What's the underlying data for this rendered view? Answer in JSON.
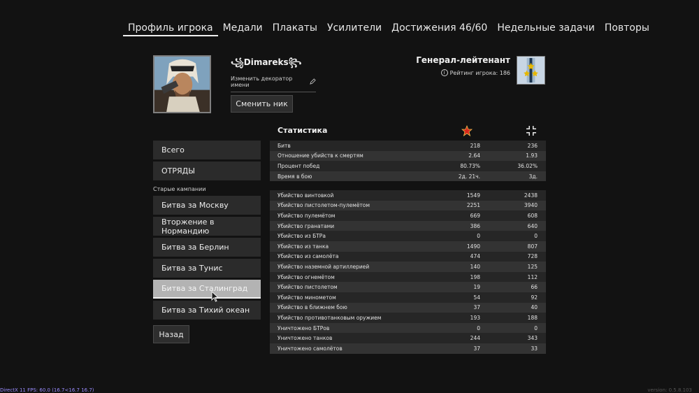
{
  "nav": {
    "tabs": [
      {
        "label": "Профиль игрока",
        "active": true
      },
      {
        "label": "Медали"
      },
      {
        "label": "Плакаты"
      },
      {
        "label": "Усилители"
      },
      {
        "label": "Достижения 46/60"
      },
      {
        "label": "Недельные задачи"
      },
      {
        "label": "Повторы"
      }
    ]
  },
  "profile": {
    "nickname": "꧁Dimareks꧂",
    "decorator_label": "Изменить декоратор имени",
    "change_nick_label": "Сменить ник",
    "rank_name": "Генерал-лейтенант",
    "rating_label": "Рейтинг игрока: 186"
  },
  "menu": {
    "all_label": "Всего",
    "squads_label": "ОТРЯДЫ",
    "old_campaigns_label": "Старые кампании",
    "campaigns": [
      "Битва за Москву",
      "Вторжение в Нормандию",
      "Битва за Берлин",
      "Битва за Тунис",
      "Битва за Сталинград",
      "Битва за Тихий океан"
    ],
    "active_campaign": "Битва за Сталинград",
    "back_label": "Назад"
  },
  "stats": {
    "title": "Статистика",
    "summary": [
      {
        "label": "Битв",
        "allies": "218",
        "axis": "236"
      },
      {
        "label": "Отношение убийств к смертям",
        "allies": "2.64",
        "axis": "1.93"
      },
      {
        "label": "Процент побед",
        "allies": "80.73%",
        "axis": "36.02%"
      },
      {
        "label": "Время в бою",
        "allies": "2д. 21ч.",
        "axis": "3д."
      }
    ],
    "kills": [
      {
        "label": "Убийство винтовкой",
        "allies": "1549",
        "axis": "2438"
      },
      {
        "label": "Убийство пистолетом-пулемётом",
        "allies": "2251",
        "axis": "3940"
      },
      {
        "label": "Убийство пулемётом",
        "allies": "669",
        "axis": "608"
      },
      {
        "label": "Убийство гранатами",
        "allies": "386",
        "axis": "640"
      },
      {
        "label": "Убийство из БТРа",
        "allies": "0",
        "axis": "0"
      },
      {
        "label": "Убийство из танка",
        "allies": "1490",
        "axis": "807"
      },
      {
        "label": "Убийство из самолёта",
        "allies": "474",
        "axis": "728"
      },
      {
        "label": "Убийство наземной артиллерией",
        "allies": "140",
        "axis": "125"
      },
      {
        "label": "Убийство огнемётом",
        "allies": "198",
        "axis": "112"
      },
      {
        "label": "Убийство пистолетом",
        "allies": "19",
        "axis": "66"
      },
      {
        "label": "Убийство минометом",
        "allies": "54",
        "axis": "92"
      },
      {
        "label": "Убийство в ближнем бою",
        "allies": "37",
        "axis": "40"
      },
      {
        "label": "Убийство противотанковым оружием",
        "allies": "193",
        "axis": "188"
      },
      {
        "label": "Уничтожено БТРов",
        "allies": "0",
        "axis": "0"
      },
      {
        "label": "Уничтожено танков",
        "allies": "244",
        "axis": "343"
      },
      {
        "label": "Уничтожено самолётов",
        "allies": "37",
        "axis": "33"
      }
    ]
  },
  "footer": {
    "fps": "DirectX 11 FPS: 60.0 (16.7<16.7 16.7)",
    "version": "version: 0.5.8.103"
  },
  "colors": {
    "allies_star": "#d9261c",
    "background": "#121212",
    "row_odd": "#262626",
    "row_even": "#333333"
  }
}
